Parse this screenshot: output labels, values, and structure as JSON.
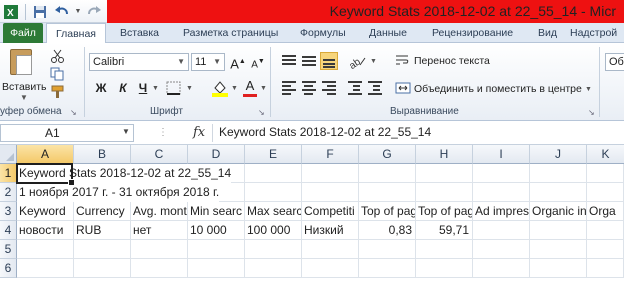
{
  "window": {
    "title": "Keyword Stats 2018-12-02 at 22_55_14  -  Micr"
  },
  "quick_access": {
    "icons": [
      "excel-app-icon",
      "save-icon",
      "undo-icon",
      "redo-icon",
      "customize-qat-icon"
    ]
  },
  "ribbon_tabs": [
    {
      "label": "Файл",
      "active": false
    },
    {
      "label": "Главная",
      "active": true
    },
    {
      "label": "Вставка",
      "active": false
    },
    {
      "label": "Разметка страницы",
      "active": false
    },
    {
      "label": "Формулы",
      "active": false
    },
    {
      "label": "Данные",
      "active": false
    },
    {
      "label": "Рецензирование",
      "active": false
    },
    {
      "label": "Вид",
      "active": false
    },
    {
      "label": "Надстрой",
      "active": false
    }
  ],
  "clipboard": {
    "paste_label": "Вставить",
    "group_label": "уфер обмена"
  },
  "font": {
    "family_value": "Calibri",
    "size_value": "11",
    "bold_label": "Ж",
    "italic_label": "К",
    "underline_label": "Ч",
    "grow_label": "A",
    "shrink_label": "A",
    "font_color_label": "A",
    "group_label": "Шрифт",
    "fill_color": "#ffff00",
    "font_color": "#e02020"
  },
  "alignment": {
    "wrap_text_label": "Перенос текста",
    "merge_center_label": "Объединить и поместить в центре",
    "group_label": "Выравнивание"
  },
  "number": {
    "format_partial": "Об"
  },
  "formula_bar": {
    "name_box": "A1",
    "fx_label": "fx",
    "formula": "Keyword Stats 2018-12-02 at 22_55_14"
  },
  "sheet": {
    "columns": [
      "A",
      "B",
      "C",
      "D",
      "E",
      "F",
      "G",
      "H",
      "I",
      "J",
      "K"
    ],
    "rows": [
      "1",
      "2",
      "3",
      "4",
      "5",
      "6"
    ],
    "selected_column": "A",
    "selected_row": "1",
    "row1_text": "Keyword Stats 2018-12-02 at 22_55_14",
    "row2_text": "1 ноября 2017 г. - 31 октября 2018 г.",
    "headers": [
      "Keyword",
      "Currency",
      "Avg. mont",
      "Min searc",
      "Max searc",
      "Competiti",
      "Top of pag",
      "Top of pag",
      "Ad impres",
      "Organic in",
      "Orga"
    ],
    "data_row": [
      "новости",
      "RUB",
      "нет",
      "10 000",
      "100 000",
      "Низкий",
      "0,83",
      "59,71",
      "",
      "",
      ""
    ]
  }
}
